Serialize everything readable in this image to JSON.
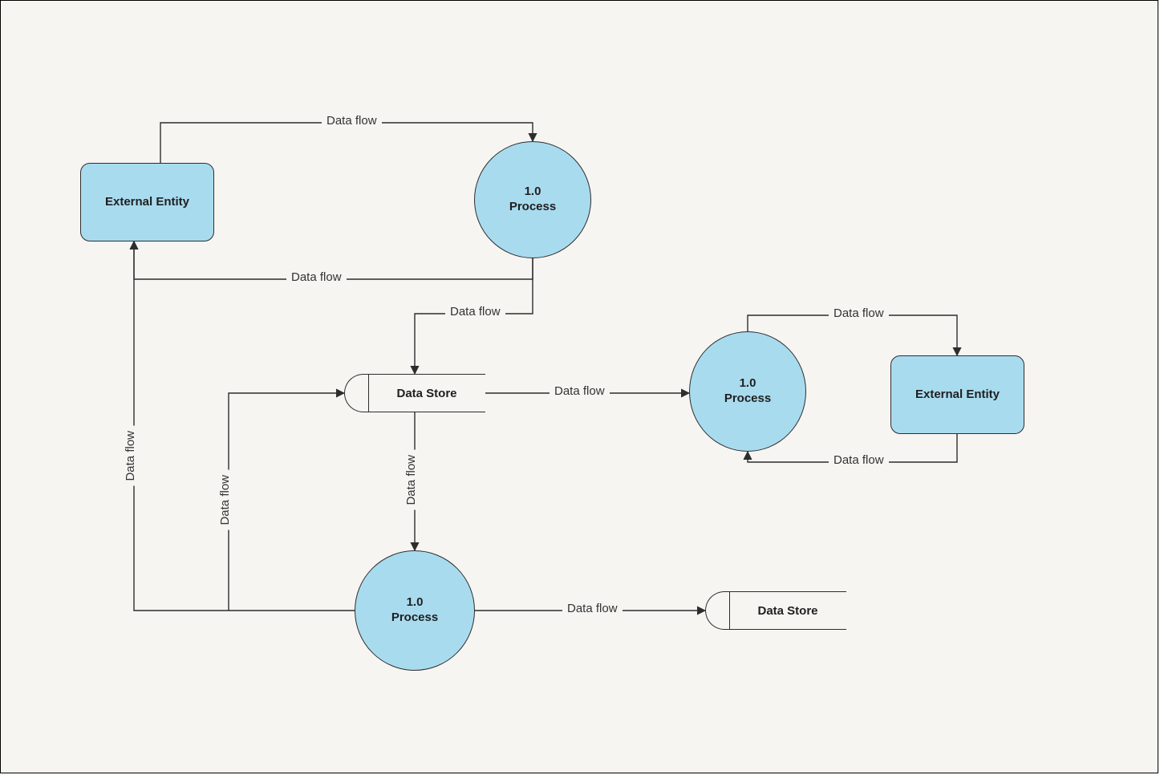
{
  "diagram": {
    "type": "data-flow-diagram",
    "nodes": {
      "entity1": {
        "label": "External Entity"
      },
      "entity2": {
        "label": "External Entity"
      },
      "process1": {
        "number": "1.0",
        "label": "Process"
      },
      "process2": {
        "number": "1.0",
        "label": "Process"
      },
      "process3": {
        "number": "1.0",
        "label": "Process"
      },
      "datastore1": {
        "label": "Data Store"
      },
      "datastore2": {
        "label": "Data Store"
      }
    },
    "flows": {
      "f_entity1_to_process1": "Data flow",
      "f_process1_to_entity1": "Data flow",
      "f_process1_to_datastore1": "Data flow",
      "f_datastore1_to_process2": "Data flow",
      "f_process2_to_entity2": "Data flow",
      "f_entity2_to_process2": "Data flow",
      "f_datastore1_to_process3_down": "Data flow",
      "f_process3_to_datastore1_up": "Data flow",
      "f_process3_to_entity1": "Data flow",
      "f_process3_to_datastore2": "Data flow"
    },
    "colors": {
      "node_fill": "#a9dbef",
      "stroke": "#2d2d2d",
      "background": "#f6f5f2"
    }
  }
}
